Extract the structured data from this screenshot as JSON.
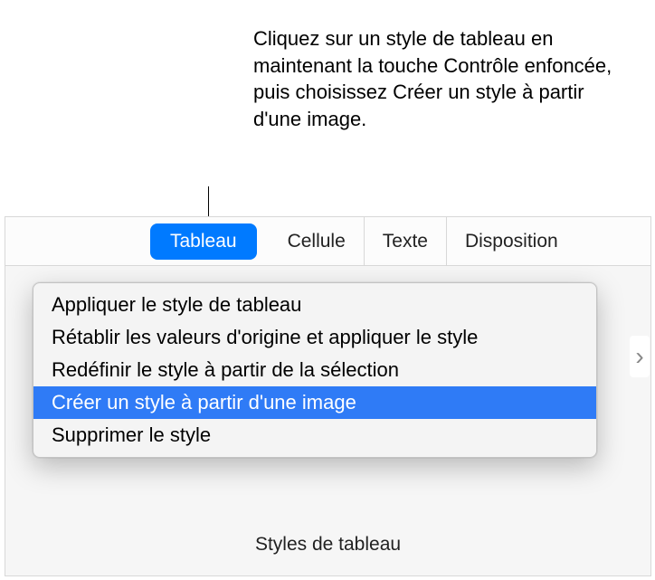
{
  "callout": {
    "text": "Cliquez sur un style de tableau en maintenant la touche Contrôle enfoncée, puis choisissez Créer un style à partir d'une image."
  },
  "tabs": [
    {
      "label": "Tableau",
      "active": true
    },
    {
      "label": "Cellule",
      "active": false
    },
    {
      "label": "Texte",
      "active": false
    },
    {
      "label": "Disposition",
      "active": false
    }
  ],
  "menu": {
    "items": [
      {
        "label": "Appliquer le style de tableau",
        "highlighted": false
      },
      {
        "label": "Rétablir les valeurs d'origine et appliquer le style",
        "highlighted": false
      },
      {
        "label": "Redéfinir le style à partir de la sélection",
        "highlighted": false
      },
      {
        "label": "Créer un style à partir d'une image",
        "highlighted": true
      },
      {
        "label": "Supprimer le style",
        "highlighted": false
      }
    ]
  },
  "footer": {
    "label": "Styles de tableau"
  },
  "chevron": "›"
}
